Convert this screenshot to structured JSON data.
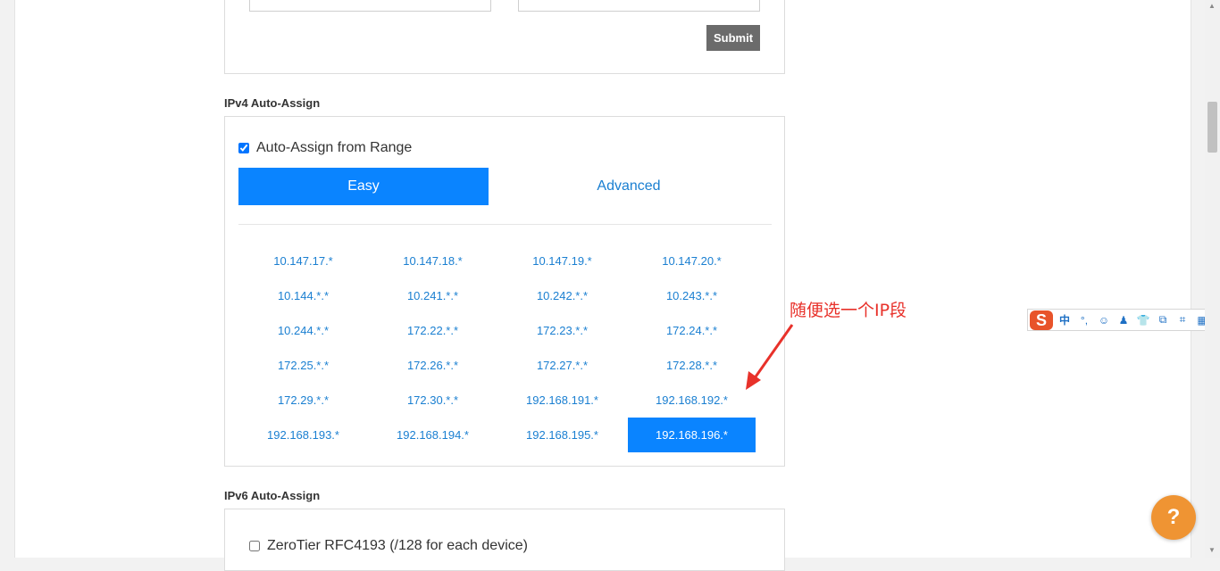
{
  "form": {
    "submit_label": "Submit"
  },
  "ipv4": {
    "section_title": "IPv4 Auto-Assign",
    "checkbox_label": "Auto-Assign from Range",
    "checked": true,
    "tabs": {
      "easy": "Easy",
      "advanced": "Advanced"
    },
    "ranges": [
      "10.147.17.*",
      "10.147.18.*",
      "10.147.19.*",
      "10.147.20.*",
      "10.144.*.*",
      "10.241.*.*",
      "10.242.*.*",
      "10.243.*.*",
      "10.244.*.*",
      "172.22.*.*",
      "172.23.*.*",
      "172.24.*.*",
      "172.25.*.*",
      "172.26.*.*",
      "172.27.*.*",
      "172.28.*.*",
      "172.29.*.*",
      "172.30.*.*",
      "192.168.191.*",
      "192.168.192.*",
      "192.168.193.*",
      "192.168.194.*",
      "192.168.195.*",
      "192.168.196.*"
    ],
    "selected_range": "192.168.196.*"
  },
  "annotation": {
    "text": "随便选一个IP段",
    "color": "#e8312a"
  },
  "ipv6": {
    "section_title": "IPv6 Auto-Assign",
    "checkbox_label": "ZeroTier RFC4193 (/128 for each device)"
  },
  "ime_toolbar": {
    "logo": "S",
    "mode": "中",
    "items": [
      "°,",
      "☺",
      "♟",
      "👕",
      "⧉",
      "⌗",
      "▦"
    ]
  },
  "help": {
    "label": "?"
  },
  "colors": {
    "accent": "#0a84ff",
    "link": "#1a7fd1",
    "help": "#ef9433"
  }
}
